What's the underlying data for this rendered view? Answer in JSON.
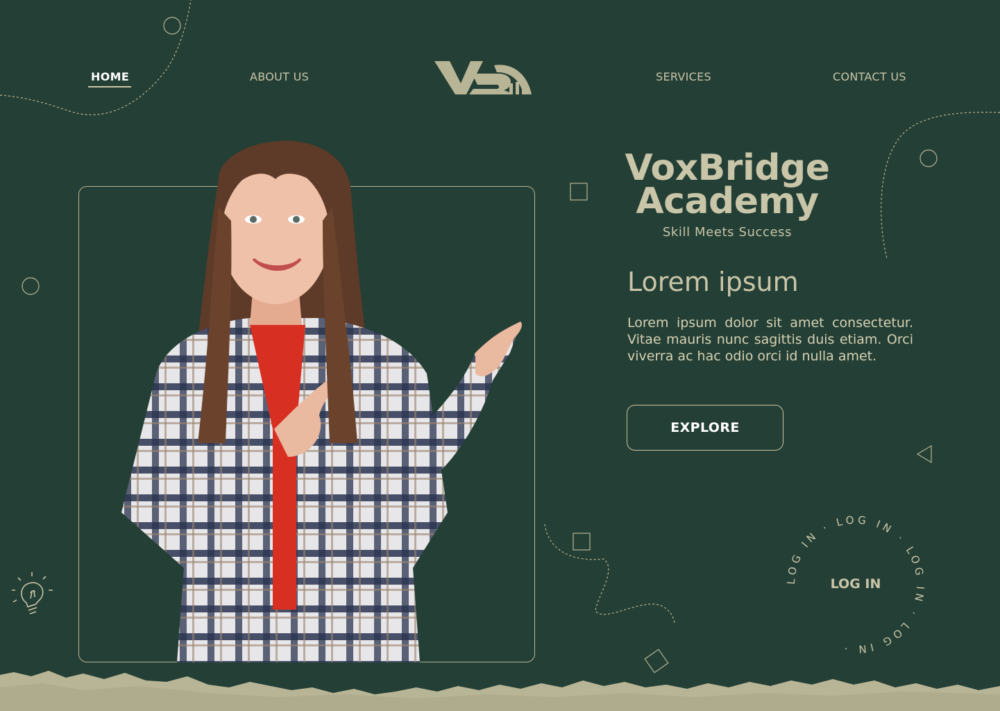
{
  "nav": {
    "home": "HOME",
    "about": "ABOUT US",
    "services": "SERVICES",
    "contact": "CONTACT US"
  },
  "hero": {
    "brand_line1": "VoxBridge",
    "brand_line2": "Academy",
    "tagline": "Skill Meets Success",
    "heading": "Lorem ipsum",
    "text": "Lorem ipsum dolor sit amet consectetur. Vitae mauris nunc sagittis duis etiam. Orci viverra ac hac odio orci id nulla amet.",
    "cta": "EXPLORE"
  },
  "login": {
    "label": "LOG IN",
    "ring_text": "LOG IN · LOG IN · LOG IN · LOG IN ·"
  },
  "icons": {
    "logo": "vb-logo-icon",
    "idea": "lightbulb-icon"
  },
  "colors": {
    "background": "#243f35",
    "accent": "#c9c5a8",
    "paper": "#b8b596"
  }
}
